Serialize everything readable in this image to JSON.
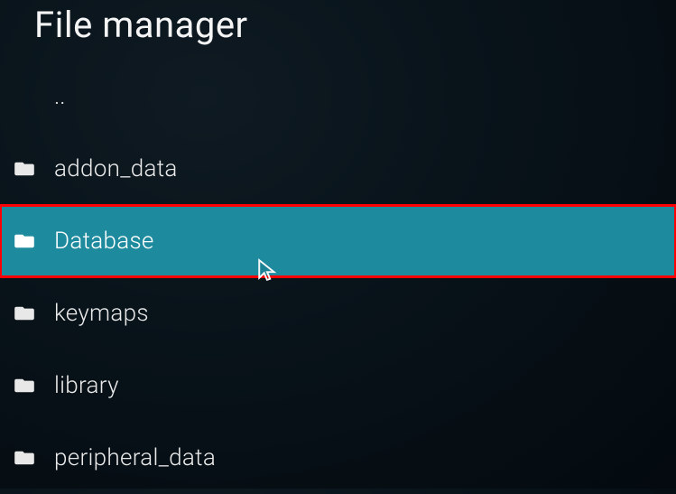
{
  "title": "File manager",
  "items": [
    {
      "label": "..",
      "type": "parent"
    },
    {
      "label": "addon_data",
      "type": "folder"
    },
    {
      "label": "Database",
      "type": "folder",
      "selected": true
    },
    {
      "label": "keymaps",
      "type": "folder"
    },
    {
      "label": "library",
      "type": "folder"
    },
    {
      "label": "peripheral_data",
      "type": "folder"
    }
  ],
  "colors": {
    "accent": "#1d8a9e",
    "highlight_border": "#ff0004",
    "text": "#e8e8e8",
    "background": "#08131a"
  }
}
